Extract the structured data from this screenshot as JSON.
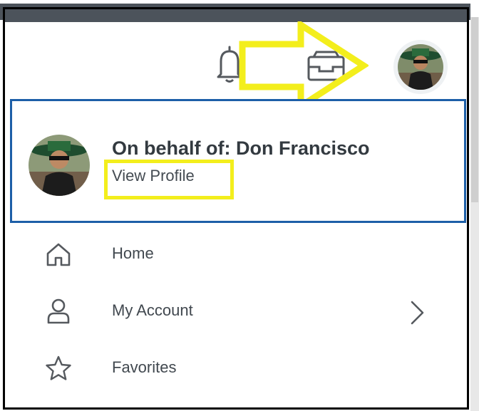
{
  "header": {
    "icons": [
      "bell-icon",
      "inbox-icon",
      "avatar"
    ]
  },
  "profile": {
    "behalf_text": "On behalf of: Don Francisco",
    "view_profile_label": "View Profile"
  },
  "menu": {
    "items": [
      {
        "label": "Home",
        "icon": "home-icon"
      },
      {
        "label": "My Account",
        "icon": "user-icon",
        "has_submenu": true
      },
      {
        "label": "Favorites",
        "icon": "star-icon"
      }
    ]
  },
  "annotation_colors": {
    "highlight": "#f3ee1c",
    "selection_border": "#1d5fa8"
  }
}
